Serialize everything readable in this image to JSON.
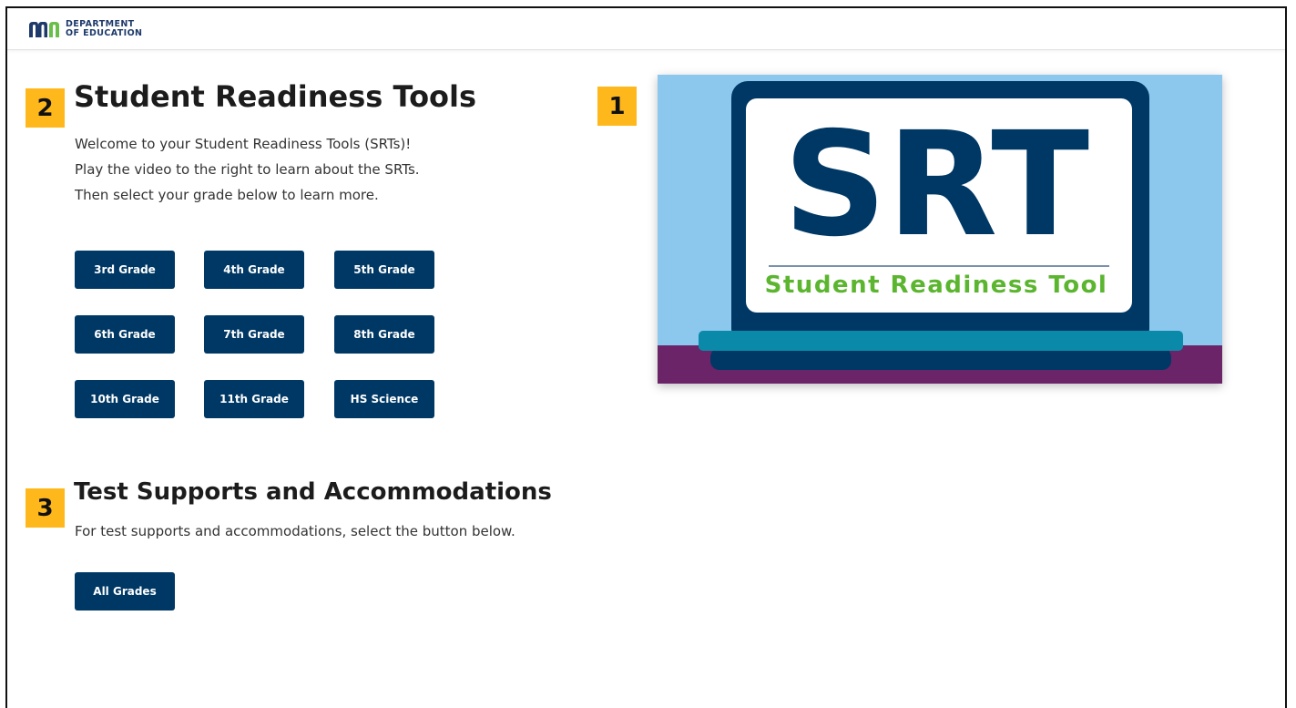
{
  "header": {
    "logo_mark": "mn",
    "logo_text": "DEPARTMENT\nOF EDUCATION"
  },
  "markers": {
    "video": "1",
    "intro": "2",
    "supports": "3"
  },
  "intro": {
    "title": "Student Readiness Tools",
    "lines": [
      "Welcome to your Student Readiness Tools (SRTs)!",
      "Play the video to the right to learn about the SRTs.",
      "Then select your grade below to learn more."
    ]
  },
  "grade_buttons": [
    "3rd Grade",
    "4th Grade",
    "5th Grade",
    "6th Grade",
    "7th Grade",
    "8th Grade",
    "10th Grade",
    "11th Grade",
    "HS Science"
  ],
  "supports": {
    "title": "Test Supports and Accommodations",
    "description": "For test supports and accommodations, select the button below.",
    "button_label": "All Grades"
  },
  "video": {
    "big_text": "SRT",
    "caption": "Student Readiness Tool"
  },
  "colors": {
    "button": "#003865",
    "marker": "#ffb81c",
    "sky": "#8cc8ee",
    "navy": "#003865",
    "green": "#5bb52f",
    "teal": "#0a8aa8",
    "purple": "#6a2467"
  }
}
